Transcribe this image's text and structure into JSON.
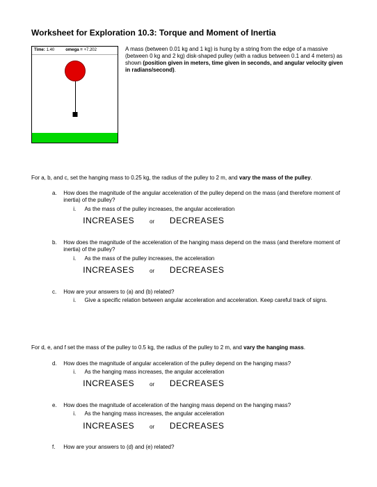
{
  "title": "Worksheet for Exploration 10.3: Torque and Moment of Inertia",
  "sim": {
    "time_label": "Time:",
    "time_value": "1.40",
    "omega_label": "omega =",
    "omega_value": "+7.202"
  },
  "intro": "A mass (between 0.01 kg and 1 kg) is hung by a string from the edge of a massive (between 0 kg and 2 kg) disk-shaped pulley (with a radius between 0.1 and 4 meters) as shown (position given in meters, time given in seconds, and angular velocity given in radians/second).",
  "section1_note_pre": "For a, b, and c, set the hanging mass to 0.25 kg, the radius of the pulley to 2 m, and ",
  "section1_note_bold": "vary the mass of the pulley",
  "section1_note_post": ".",
  "qa": {
    "label": "a.",
    "text": "How does the magnitude of the angular acceleration of the pulley depend on the mass (and therefore moment of inertia) of the pulley?",
    "sub_label": "i.",
    "sub_text": "As the mass of the pulley increases, the angular acceleration"
  },
  "qb": {
    "label": "b.",
    "text": "How does the magnitude of the acceleration of the hanging mass depend on the mass (and therefore moment of inertia) of the pulley?",
    "sub_label": "i.",
    "sub_text": "As the mass of the pulley increases, the acceleration"
  },
  "qc": {
    "label": "c.",
    "text": "How are your answers to (a) and (b) related?",
    "sub_label": "i.",
    "sub_text": "Give a specific relation between angular acceleration and acceleration. Keep careful track of signs."
  },
  "section2_note_pre": "For d, e, and f set the mass of the pulley to 0.5 kg, the radius of the pulley to 2 m, and ",
  "section2_note_bold": "vary the hanging mass",
  "section2_note_post": ".",
  "qd": {
    "label": "d.",
    "text": "How does the magnitude of angular acceleration of the pulley depend on the hanging mass?",
    "sub_label": "i.",
    "sub_text": "As the hanging mass increases, the angular acceleration"
  },
  "qe": {
    "label": "e.",
    "text": "How does the magnitude of acceleration of the hanging mass depend on the hanging mass?",
    "sub_label": "i.",
    "sub_text": "As the hanging mass increases, the angular acceleration"
  },
  "qf": {
    "label": "f.",
    "text": "How are your answers to (d) and (e) related?"
  },
  "choices": {
    "inc": "INCREASES",
    "or": "or",
    "dec": "DECREASES"
  }
}
